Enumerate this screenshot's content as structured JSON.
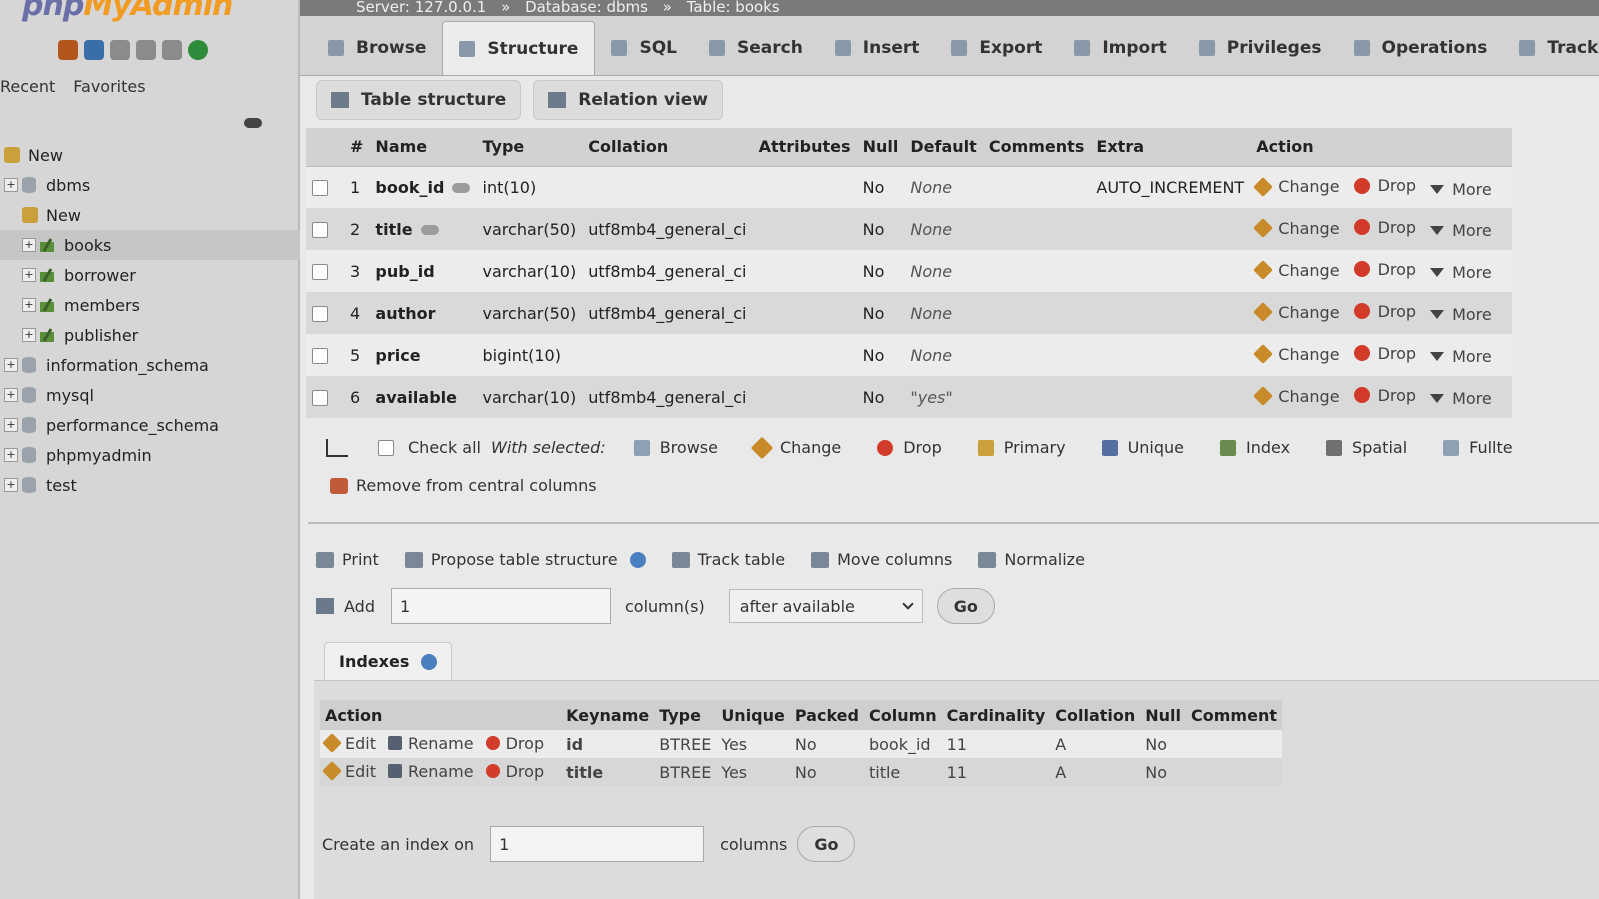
{
  "sidebar": {
    "logo_part1": "php",
    "logo_part2": "MyAdmin",
    "recent": "Recent",
    "favorites": "Favorites",
    "tree": [
      {
        "label": "New",
        "level": 0
      },
      {
        "label": "dbms",
        "level": 0
      },
      {
        "label": "New",
        "level": 1
      },
      {
        "label": "books",
        "level": 1
      },
      {
        "label": "borrower",
        "level": 1
      },
      {
        "label": "members",
        "level": 1
      },
      {
        "label": "publisher",
        "level": 1
      },
      {
        "label": "information_schema",
        "level": 0
      },
      {
        "label": "mysql",
        "level": 0
      },
      {
        "label": "performance_schema",
        "level": 0
      },
      {
        "label": "phpmyadmin",
        "level": 0
      },
      {
        "label": "test",
        "level": 0
      }
    ]
  },
  "breadcrumb": {
    "server": "Server: 127.0.0.1",
    "sep": "»",
    "database": "Database: dbms",
    "table": "Table: books"
  },
  "tabs": [
    "Browse",
    "Structure",
    "SQL",
    "Search",
    "Insert",
    "Export",
    "Import",
    "Privileges",
    "Operations",
    "Tracki"
  ],
  "subtabs": {
    "table_structure": "Table structure",
    "relation_view": "Relation view"
  },
  "structure": {
    "headers": [
      "#",
      "Name",
      "Type",
      "Collation",
      "Attributes",
      "Null",
      "Default",
      "Comments",
      "Extra",
      "Action"
    ],
    "rows": [
      {
        "num": "1",
        "name": "book_id",
        "key": true,
        "type": "int(10)",
        "collation": "",
        "attributes": "",
        "null": "No",
        "default": "None",
        "comments": "",
        "extra": "AUTO_INCREMENT"
      },
      {
        "num": "2",
        "name": "title",
        "key": true,
        "type": "varchar(50)",
        "collation": "utf8mb4_general_ci",
        "attributes": "",
        "null": "No",
        "default": "None",
        "comments": "",
        "extra": ""
      },
      {
        "num": "3",
        "name": "pub_id",
        "key": false,
        "type": "varchar(10)",
        "collation": "utf8mb4_general_ci",
        "attributes": "",
        "null": "No",
        "default": "None",
        "comments": "",
        "extra": ""
      },
      {
        "num": "4",
        "name": "author",
        "key": false,
        "type": "varchar(50)",
        "collation": "utf8mb4_general_ci",
        "attributes": "",
        "null": "No",
        "default": "None",
        "comments": "",
        "extra": ""
      },
      {
        "num": "5",
        "name": "price",
        "key": false,
        "type": "bigint(10)",
        "collation": "",
        "attributes": "",
        "null": "No",
        "default": "None",
        "comments": "",
        "extra": ""
      },
      {
        "num": "6",
        "name": "available",
        "key": false,
        "type": "varchar(10)",
        "collation": "utf8mb4_general_ci",
        "attributes": "",
        "null": "No",
        "default": "\"yes\"",
        "comments": "",
        "extra": ""
      }
    ],
    "action_labels": {
      "change": "Change",
      "drop": "Drop",
      "more": "More"
    }
  },
  "with_selected": {
    "check_all": "Check all",
    "label": "With selected:",
    "buttons": [
      "Browse",
      "Change",
      "Drop",
      "Primary",
      "Unique",
      "Index",
      "Spatial",
      "Fullte"
    ],
    "remove_central": "Remove from central columns"
  },
  "tools": {
    "print": "Print",
    "propose": "Propose table structure",
    "track": "Track table",
    "move": "Move columns",
    "normalize": "Normalize"
  },
  "add_columns": {
    "label": "Add",
    "value": "1",
    "suffix": "column(s)",
    "position": "after available",
    "go": "Go"
  },
  "indexes": {
    "tab_label": "Indexes",
    "headers": [
      "Action",
      "Keyname",
      "Type",
      "Unique",
      "Packed",
      "Column",
      "Cardinality",
      "Collation",
      "Null",
      "Comment"
    ],
    "action_labels": {
      "edit": "Edit",
      "rename": "Rename",
      "drop": "Drop"
    },
    "rows": [
      {
        "keyname": "id",
        "type": "BTREE",
        "unique": "Yes",
        "packed": "No",
        "column": "book_id",
        "cardinality": "11",
        "collation": "A",
        "null": "No",
        "comment": ""
      },
      {
        "keyname": "title",
        "type": "BTREE",
        "unique": "Yes",
        "packed": "No",
        "column": "title",
        "cardinality": "11",
        "collation": "A",
        "null": "No",
        "comment": ""
      }
    ]
  },
  "create_index": {
    "label": "Create an index on",
    "value": "1",
    "suffix": "columns",
    "go": "Go"
  }
}
